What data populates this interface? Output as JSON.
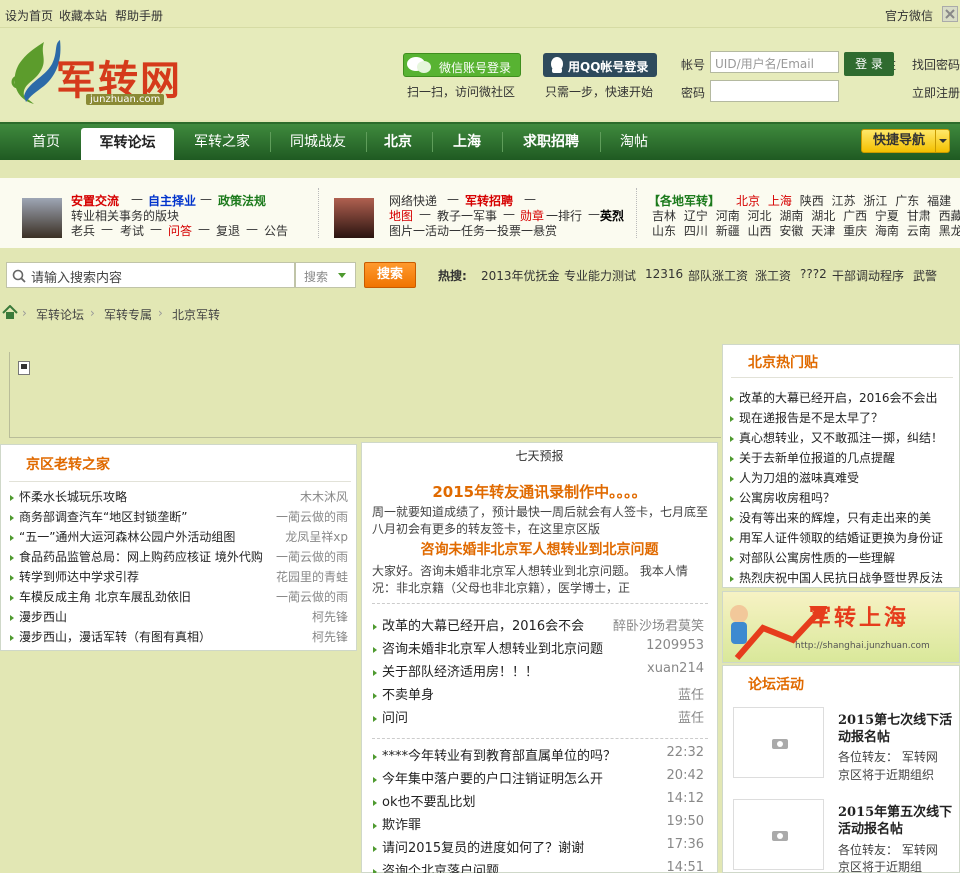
{
  "topbar": {
    "set_home": "设为首页",
    "bookmark": "收藏本站",
    "help": "帮助手册",
    "official_wechat": "官方微信"
  },
  "logo": {
    "text": "军转网",
    "sub": "junzhuan.com"
  },
  "login": {
    "wechat_btn": "微信账号登录",
    "wechat_tip": "扫一扫，访问微社区",
    "qq_btn": "用QQ帐号登录",
    "qq_tip": "只需一步，快速开始",
    "account_label": "帐号",
    "account_placeholder": "UID/用户名/Email",
    "password_label": "密码",
    "remember": "记 住",
    "login_btn": "登 录",
    "forgot": "找回密码",
    "register": "立即注册"
  },
  "nav": {
    "items": [
      "首页",
      "军转论坛",
      "军转之家",
      "同城战友",
      "北京",
      "上海",
      "求职招聘",
      "淘帖"
    ],
    "quick": "快捷导航"
  },
  "info": {
    "c1_l1": [
      "安置交流",
      "—",
      "自主择业",
      "—",
      "政策法规"
    ],
    "c1_l2": "转业相关事务的版块",
    "c1_l3": [
      "老兵",
      "—",
      "考试",
      "—",
      "问答",
      "—",
      "复退",
      "—",
      "公告"
    ],
    "c2_l1": [
      "网络快递",
      "—",
      "军转招聘",
      "—"
    ],
    "c2_l2": [
      "地图",
      "—",
      "教子一军事",
      "—",
      "勋章",
      "一排行",
      "—",
      "英烈"
    ],
    "c2_l3": "图片一活动一任务一投票一悬赏",
    "c3_title": "【各地军转】",
    "c3_r1": [
      "北京",
      "上海",
      "陕西",
      "江苏",
      "浙江",
      "广东",
      "福建"
    ],
    "c3_r2": [
      "吉林",
      "辽宁",
      "河南",
      "河北",
      "湖南",
      "湖北",
      "广西",
      "宁夏",
      "甘肃",
      "西藏"
    ],
    "c3_r3": [
      "山东",
      "四川",
      "新疆",
      "山西",
      "安徽",
      "天津",
      "重庆",
      "海南",
      "云南",
      "黑龙"
    ]
  },
  "search": {
    "placeholder": "请输入搜索内容",
    "select": "搜索",
    "btn": "搜索",
    "hot_label": "热搜:",
    "hot": [
      "2013年优抚金",
      "专业能力测试",
      "12316",
      "部队涨工资",
      "涨工资",
      "???2",
      "干部调动程序",
      "武警"
    ]
  },
  "breadcrumb": [
    "军转论坛",
    "军转专属",
    "北京军转"
  ],
  "left_panel": {
    "title": "京区老转之家",
    "items": [
      {
        "t": "怀柔水长城玩乐攻略",
        "a": "木木沐风"
      },
      {
        "t": "商务部调查汽车“地区封锁垄断”",
        "a": "一蔺云做的雨"
      },
      {
        "t": "“五一”通州大运河森林公园户外活动组图",
        "a": "龙凤呈祥xp"
      },
      {
        "t": "食品药品监管总局：网上购药应核证 境外代购",
        "a": "一蔺云做的雨"
      },
      {
        "t": "转学到师达中学求引荐",
        "a": "花园里的青蛙"
      },
      {
        "t": "车模反成主角 北京车展乱劲依旧",
        "a": "一蔺云做的雨"
      },
      {
        "t": "漫步西山",
        "a": "柯先锋"
      },
      {
        "t": "漫步西山，漫话军转（有图有真相）",
        "a": "柯先锋"
      }
    ]
  },
  "center": {
    "header": "七天预报",
    "h1": "2015年转友通讯录制作中。。。。",
    "p1a": "周一就要知道成绩了，预计最快一周后就会有人签卡，七月底至",
    "p1b": "八月初会有更多的转友签卡，在这里京区版",
    "h2": "咨询未婚非北京军人想转业到北京问题",
    "p2a": "大家好。咨询未婚非北京军人想转业到北京问题。 我本人情",
    "p2b": "况：非北京籍（父母也非北京籍），医学博士，正",
    "list1": [
      {
        "t": "改革的大幕已经开启，2016会不会",
        "a": "醉卧沙场君莫笑"
      },
      {
        "t": "咨询未婚非北京军人想转业到北京问题",
        "a": "1209953"
      },
      {
        "t": "关于部队经济适用房！！！",
        "a": "xuan214"
      },
      {
        "t": "不卖单身",
        "a": "蓝任"
      },
      {
        "t": "问问",
        "a": "蓝任"
      }
    ],
    "list2": [
      {
        "t": "****今年转业有到教育部直属单位的吗？",
        "a": "22:32"
      },
      {
        "t": "今年集中落户要的户口注销证明怎么开",
        "a": "20:42"
      },
      {
        "t": "ok也不要乱比划",
        "a": "14:12"
      },
      {
        "t": "欺诈罪",
        "a": "19:50"
      },
      {
        "t": "请问2015复员的进度如何了？谢谢",
        "a": "17:36"
      },
      {
        "t": "咨询个北京落户问题",
        "a": "14:51"
      }
    ]
  },
  "right": {
    "hot_title": "北京热门贴",
    "hot": [
      "改革的大幕已经开启，2016会不会出",
      "现在递报告是不是太早了？",
      "真心想转业，又不敢孤注一掷，纠结！",
      "关于去新单位报道的几点提醒",
      "人为刀俎的滋味真难受",
      "公寓房收房租吗？",
      "没有等出来的辉煌，只有走出来的美",
      "用军人证件领取的结婚证更换为身份证",
      "对部队公寓房性质的一些理解",
      "热烈庆祝中国人民抗日战争暨世界反法"
    ],
    "banner_text": "军转上海",
    "banner_url": "http://shanghai.junzhuan.com",
    "act_title": "论坛活动",
    "acts": [
      {
        "title1": "2015第七次线下活",
        "title2": "动报名帖",
        "d1": "各位转友： 军转网",
        "d2": "京区将于近期组织"
      },
      {
        "title1": "2015年第五次线下",
        "title2": "活动报名帖",
        "d1": "各位转友： 军转网",
        "d2": "京区将于近期组"
      }
    ]
  },
  "colors": {
    "accent_green": "#2c6b2a",
    "accent_orange": "#e06a00",
    "red": "#d60000"
  }
}
